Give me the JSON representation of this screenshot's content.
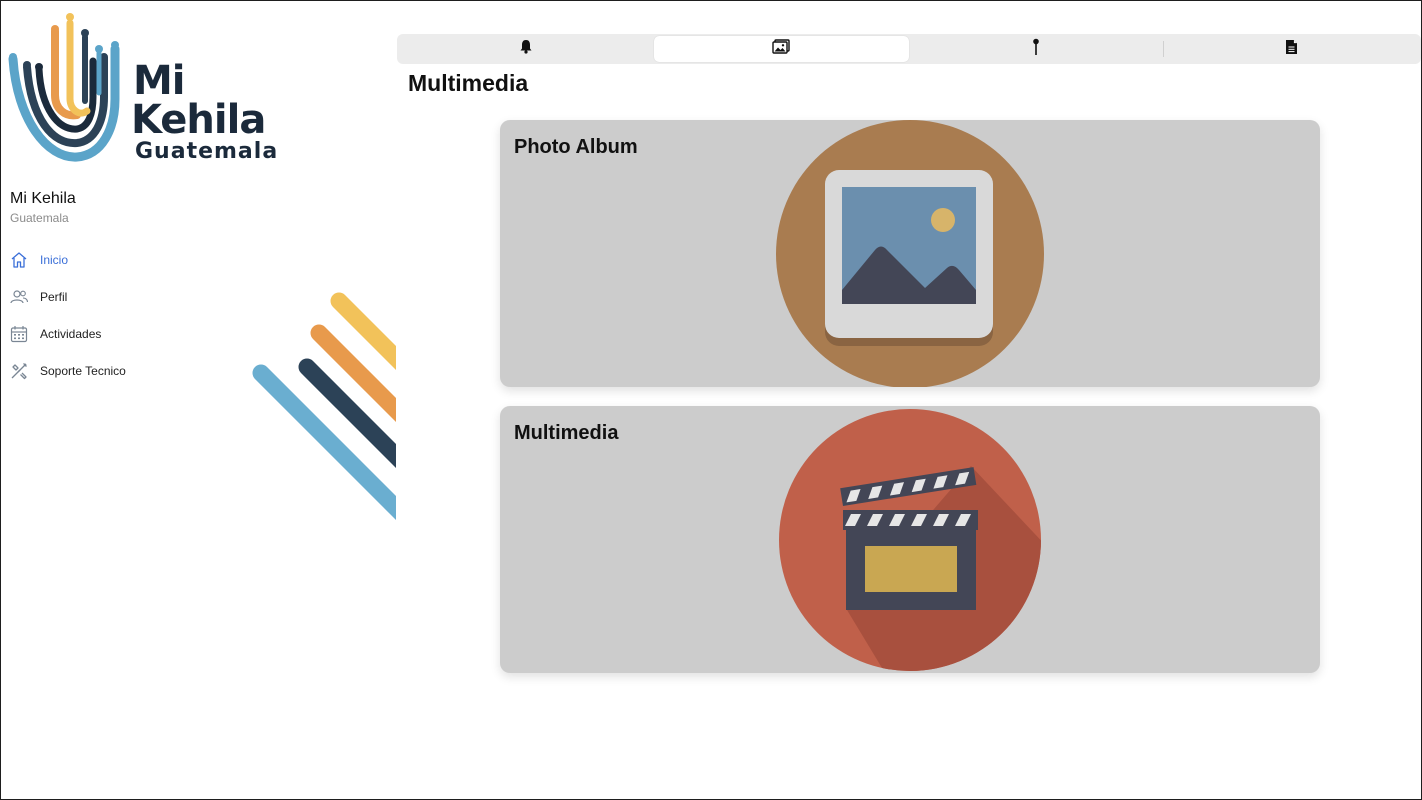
{
  "sidebar": {
    "logo": {
      "line1": "Mi",
      "line2": "Kehila",
      "line3": "Guatemala"
    },
    "profile": {
      "name": "Mi Kehila",
      "location": "Guatemala"
    },
    "nav": [
      {
        "label": "Inicio",
        "icon": "home-icon",
        "active": true
      },
      {
        "label": "Perfil",
        "icon": "users-icon",
        "active": false
      },
      {
        "label": "Actividades",
        "icon": "calendar-icon",
        "active": false
      },
      {
        "label": "Soporte Tecnico",
        "icon": "tools-icon",
        "active": false
      }
    ]
  },
  "tabs": [
    {
      "icon": "bell-icon",
      "selected": false
    },
    {
      "icon": "image-icon",
      "selected": true
    },
    {
      "icon": "pin-icon",
      "selected": false
    },
    {
      "icon": "document-icon",
      "selected": false
    }
  ],
  "main": {
    "title": "Multimedia",
    "cards": [
      {
        "title": "Photo Album",
        "icon": "photo-album-icon"
      },
      {
        "title": "Multimedia",
        "icon": "clapperboard-icon"
      }
    ]
  },
  "colors": {
    "accent": "#3b6fd8",
    "card_bg": "#cccccc",
    "photo_circle": "#a97c50",
    "media_circle": "#c0604a",
    "logo_blue": "#5ba4c9",
    "logo_orange": "#e89a4c",
    "logo_yellow": "#f2c25a",
    "logo_navy": "#2c4257"
  }
}
